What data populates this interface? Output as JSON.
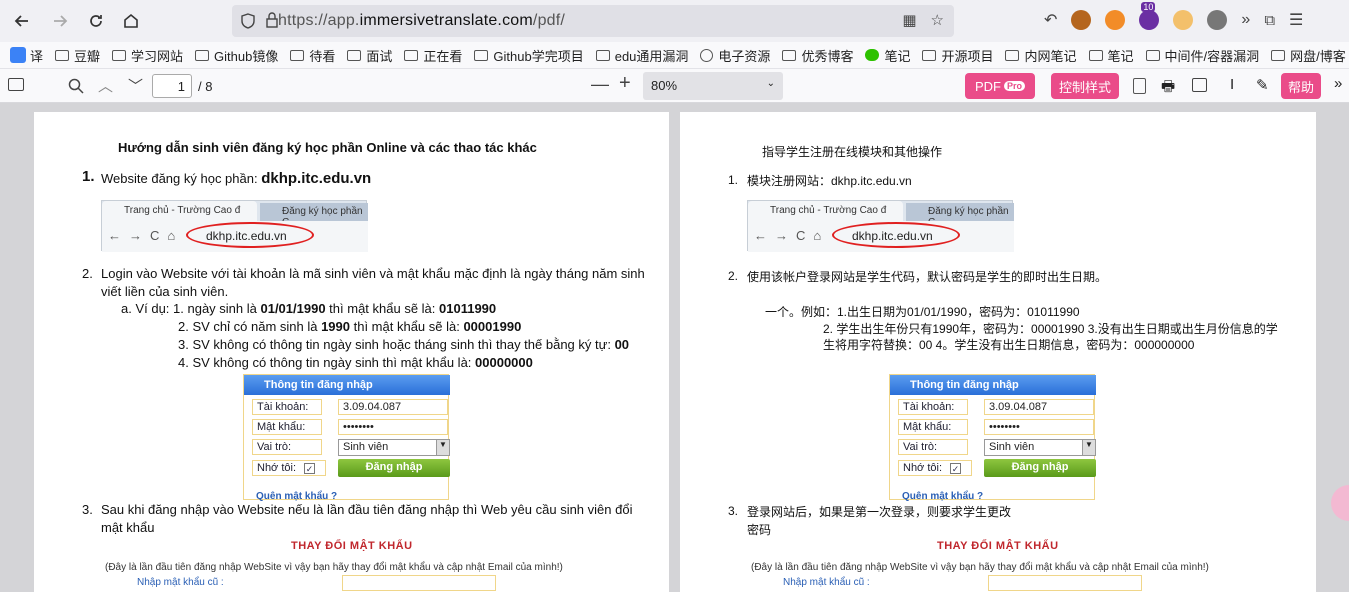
{
  "browser": {
    "url_prefix": "https://app.",
    "url_domain": "immersivetranslate.com",
    "url_path": "/pdf/",
    "ext_badge": "10"
  },
  "bookmarks": [
    {
      "label": "译",
      "icon": "translate-icon"
    },
    {
      "label": "豆瓣",
      "icon": "folder-icon"
    },
    {
      "label": "学习网站",
      "icon": "folder-icon"
    },
    {
      "label": "Github镜像",
      "icon": "folder-icon"
    },
    {
      "label": "待看",
      "icon": "folder-icon"
    },
    {
      "label": "面试",
      "icon": "folder-icon"
    },
    {
      "label": "正在看",
      "icon": "folder-icon"
    },
    {
      "label": "Github学完项目",
      "icon": "folder-icon"
    },
    {
      "label": "edu通用漏洞",
      "icon": "folder-icon"
    },
    {
      "label": "电子资源",
      "icon": "globe-icon"
    },
    {
      "label": "优秀博客",
      "icon": "folder-icon"
    },
    {
      "label": "笔记",
      "icon": "wechat-icon"
    },
    {
      "label": "开源项目",
      "icon": "folder-icon"
    },
    {
      "label": "内网笔记",
      "icon": "folder-icon"
    },
    {
      "label": "笔记",
      "icon": "folder-icon"
    },
    {
      "label": "中间件/容器漏洞",
      "icon": "folder-icon"
    },
    {
      "label": "网盘/博客",
      "icon": "folder-icon"
    }
  ],
  "pdf_toolbar": {
    "current_page": "1",
    "total_pages": "/ 8",
    "zoom": "80%",
    "pdf_pro_label": "PDF",
    "pro_badge": "Pro",
    "control_style_label": "控制样式",
    "help_label": "帮助"
  },
  "left_page": {
    "title": "Hướng dẫn sinh viên đăng ký học phần Online và các thao tác khác",
    "s1_num": "1.",
    "s1_text": "Website đăng ký học phần: ",
    "s1_site": "dkhp.itc.edu.vn",
    "s2_num": "2.",
    "s2_line1": "Login vào Website với tài khoản là mã sinh viên và mật khẩu mặc định là ngày tháng năm sinh",
    "s2_line2": "viết liền của sinh viên.",
    "ex_a_prefix": "a.  Ví dụ: 1.  ngày sinh là ",
    "ex_a_date": "01/01/1990",
    "ex_a_mid": " thì mật khẩu sẽ là: ",
    "ex_a_pw": "01011990",
    "ex2_prefix": "2. SV chỉ có năm sinh là ",
    "ex2_year": "1990",
    "ex2_mid": " thì mật khẩu sẽ là: ",
    "ex2_pw": "00001990",
    "ex3_prefix": "3. SV không có thông tin ngày sinh hoặc tháng sinh thì thay thế bằng ký tự: ",
    "ex3_pw": "00",
    "ex4_prefix": "4. SV không có thông tin ngày sinh thì mật khẩu là: ",
    "ex4_pw": "00000000",
    "s3_num": "3.",
    "s3_line1": "Sau khi đăng nhập vào Website  nếu là lần đầu tiên đăng nhập thì Web yêu cầu sinh viên đổi",
    "s3_line2": "mật khẩu"
  },
  "right_page": {
    "title": "指导学生注册在线模块和其他操作",
    "s1_num": "1.",
    "s1_text": "模块注册网站：dkhp.itc.edu.vn",
    "s2_num": "2.",
    "s2_text": "使用该帐户登录网站是学生代码，默认密码是学生的即时出生日期。",
    "ex_line1": "一个。例如：1.出生日期为01/01/1990，密码为：01011990",
    "ex_line2": "2. 学生出生年份只有1990年，密码为：00001990 3.没有出生日期或出生月份信息的学",
    "ex_line3": "生将用字符替换：00 4。学生没有出生日期信息，密码为：000000000",
    "s3_num": "3.",
    "s3_line1": "登录网站后，如果是第一次登录，则要求学生更改",
    "s3_line2": "密码"
  },
  "mini_browser": {
    "tab1": "Trang chủ - Trường Cao đ",
    "tab2": "Đăng ký học phần C",
    "address": "dkhp.itc.edu.vn"
  },
  "login_form": {
    "header": "Thông tin đăng nhập",
    "account_label": "Tài khoản:",
    "account_value": "3.09.04.087",
    "password_label": "Mật khẩu:",
    "password_value": "••••••••",
    "role_label": "Vai trò:",
    "role_value": "Sinh viên",
    "remember_label": "Nhớ tôi:",
    "login_button": "Đăng nhập",
    "forgot": "Quên mật khẩu ?"
  },
  "change_password": {
    "title": "THAY ĐỔI MẬT KHẨU",
    "note": "(Đây là lần đầu tiên đăng nhập WebSite vì vậy bạn hãy thay đổi mật khẩu và cập nhật Email của mình!)",
    "old_label": "Nhập mật khẩu cũ :"
  }
}
